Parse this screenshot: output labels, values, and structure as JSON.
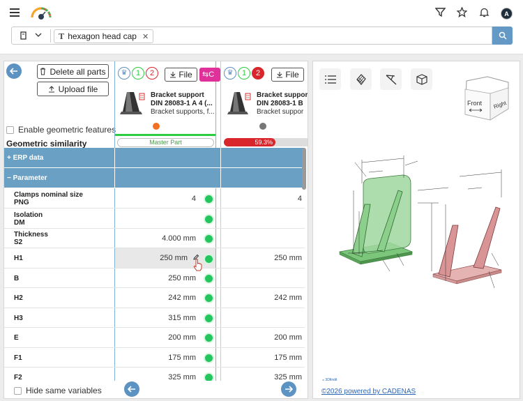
{
  "search": {
    "chip_label": "hexagon head cap"
  },
  "toolbar": {
    "delete_all_label": "Delete all parts",
    "upload_label": "Upload file"
  },
  "options": {
    "enable_geometric_label": "Enable geometric features",
    "geometric_similarity_label": "Geometric similarity",
    "hide_same_label": "Hide same variables"
  },
  "parts": [
    {
      "badge_green": "1",
      "badge_red": "2",
      "file_label": "File",
      "pink_label": "C",
      "title_line1": "Bracket support",
      "title_line2": "DIN 28083-1 A 4 (...",
      "description": "Bracket supports, f...",
      "status_color": "#f36f21",
      "master_label": "Master Part"
    },
    {
      "badge_green": "1",
      "badge_red": "2",
      "file_label": "File",
      "title_line1": "Bracket suppor",
      "title_line2": "DIN 28083-1 B",
      "description": "Bracket suppor",
      "status_color": "#777777",
      "similarity": "59.3",
      "similarity_percent": 59.3
    }
  ],
  "sections": {
    "erp": "+ ERP data",
    "parameter": "− Parameter"
  },
  "rows": [
    {
      "label1": "Clamps nominal size",
      "label2": "PNG",
      "v1": "4",
      "v2": "4"
    },
    {
      "label1": "Isolation",
      "label2": "DM",
      "v1": "",
      "v2": ""
    },
    {
      "label1": "Thickness",
      "label2": "S2",
      "v1": "4.000 mm",
      "v2": ""
    },
    {
      "label1": "H1",
      "label2": "",
      "v1": "250 mm",
      "v2": "250 mm"
    },
    {
      "label1": "B",
      "label2": "",
      "v1": "250 mm",
      "v2": ""
    },
    {
      "label1": "H2",
      "label2": "",
      "v1": "242 mm",
      "v2": "242 mm"
    },
    {
      "label1": "H3",
      "label2": "",
      "v1": "315 mm",
      "v2": ""
    },
    {
      "label1": "E",
      "label2": "",
      "v1": "200 mm",
      "v2": "200 mm"
    },
    {
      "label1": "F1",
      "label2": "",
      "v1": "175 mm",
      "v2": "175 mm"
    },
    {
      "label1": "F2",
      "label2": "",
      "v1": "325 mm",
      "v2": "325 mm"
    }
  ],
  "viewer": {
    "cube_front": "Front",
    "cube_right": "Right",
    "footer_link": "©2026 powered by CADENAS",
    "brand_small": "3Dfindit"
  },
  "colors": {
    "accent": "#5d93c2",
    "section": "#6aa0c3",
    "pink": "#e0309a",
    "ok_dot": "#22c55e"
  }
}
